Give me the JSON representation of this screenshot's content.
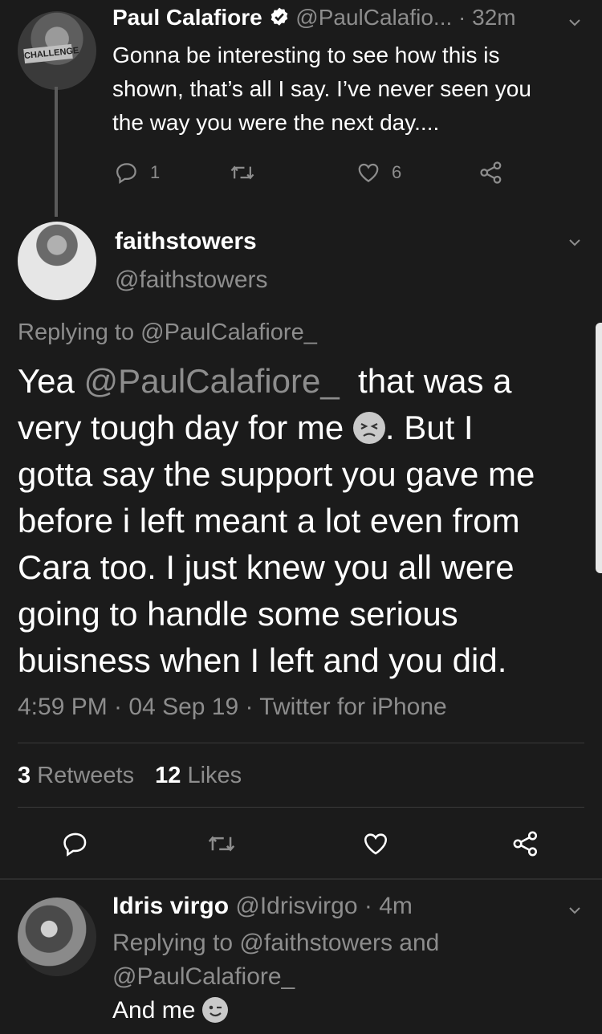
{
  "tweet1": {
    "name": "Paul Calafiore",
    "handle": "@PaulCalafio...",
    "time": "· 32m",
    "text_lines": [
      "Gonna be interesting to see how this is",
      "shown, that’s all I say. I’ve never seen you",
      "the way you were the next day...."
    ],
    "avatar_badge": "CHALLENGE",
    "reply_count": "1",
    "retweet_count": "",
    "like_count": "6"
  },
  "main_tweet": {
    "name": "faithstowers",
    "handle": "@faithstowers",
    "replying_prefix": "Replying to ",
    "replying_to": "@PaulCalafiore_",
    "text": {
      "line1_pre": "Yea ",
      "line1_mention": "@PaulCalafiore_",
      "line1_post": "  that was a",
      "line2_pre": "very tough day for me ",
      "line2_post": ". But I",
      "line3": "gotta say the support you gave me",
      "line4": "before i left meant a lot even from",
      "line5": "Cara too. I just knew you all were",
      "line6": "going to handle some serious",
      "line7": "buisness when I left and you did."
    },
    "timestamp": "4:59 PM · 04 Sep 19 · Twitter for iPhone",
    "retweets_count": "3",
    "retweets_label": "Retweets",
    "likes_count": "12",
    "likes_label": "Likes"
  },
  "reply": {
    "name": "Idris virgo",
    "handle": "@Idrisvirgo",
    "time": "· 4m",
    "replying_line1": "Replying to @faithstowers and",
    "replying_line2": "@PaulCalafiore_",
    "text": "And me"
  },
  "colors": {
    "background": "#1b1b1b",
    "text": "#ffffff",
    "muted": "#8d8d8d",
    "divider": "#3a3a3a"
  },
  "icons": [
    "reply-icon",
    "retweet-icon",
    "like-icon",
    "share-icon",
    "verified-icon",
    "chevron-down-icon"
  ]
}
